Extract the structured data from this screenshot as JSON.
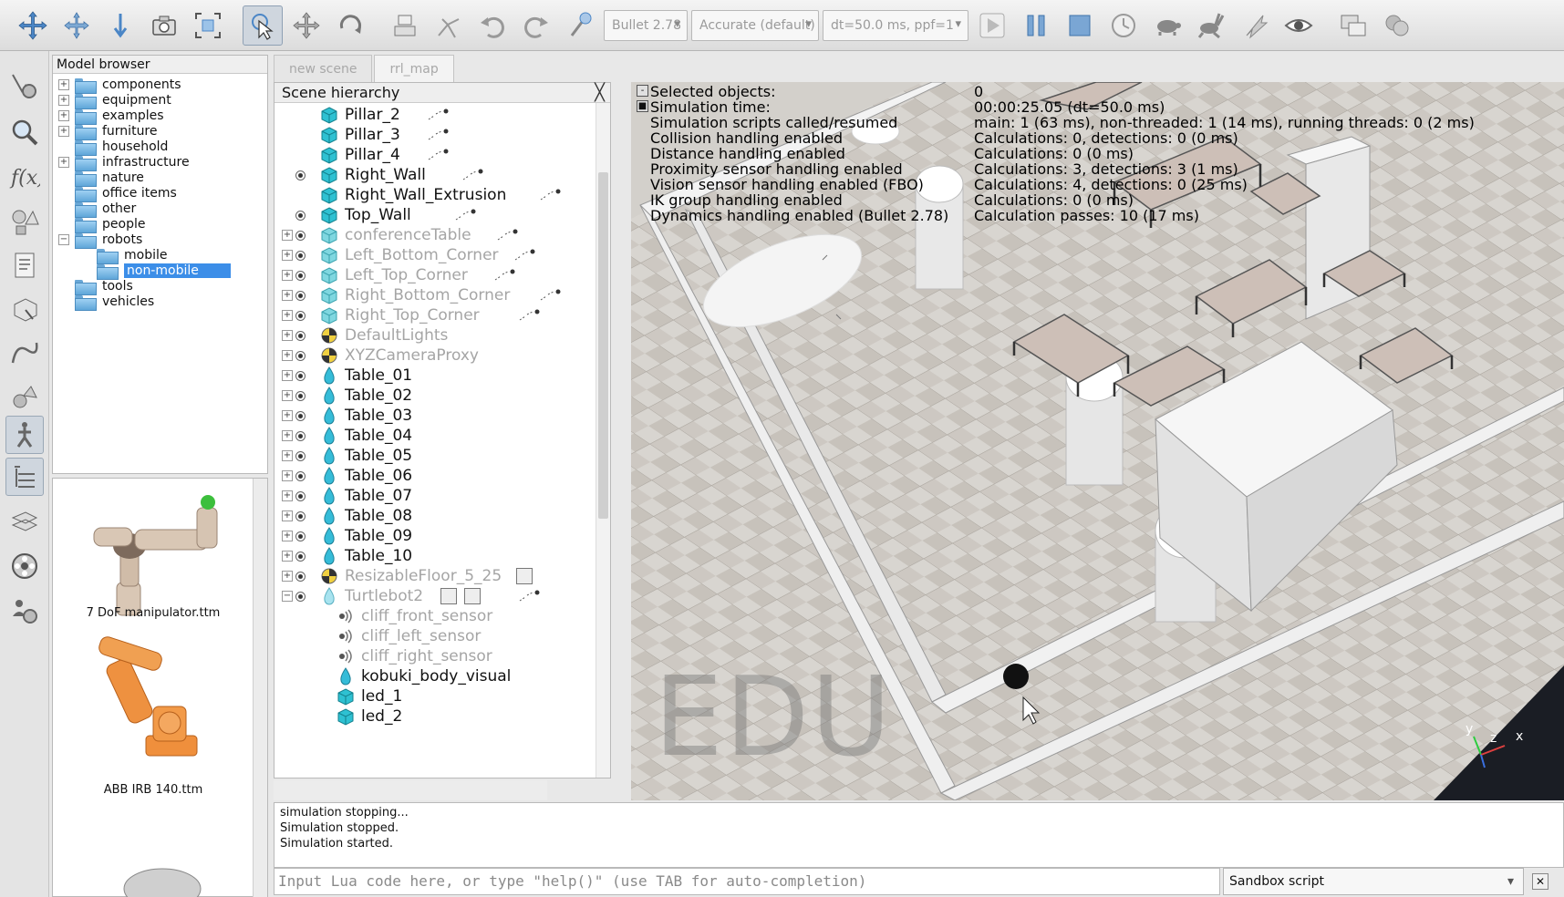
{
  "toolbar": {
    "engine": "Bullet 2.78",
    "accuracy": "Accurate (default)",
    "timestep": "dt=50.0 ms, ppf=1"
  },
  "model_browser": {
    "title": "Model browser",
    "folders": [
      {
        "label": "components",
        "expander": "+"
      },
      {
        "label": "equipment",
        "expander": "+"
      },
      {
        "label": "examples",
        "expander": "+"
      },
      {
        "label": "furniture",
        "expander": "+"
      },
      {
        "label": "household",
        "expander": ""
      },
      {
        "label": "infrastructure",
        "expander": "+"
      },
      {
        "label": "nature",
        "expander": ""
      },
      {
        "label": "office items",
        "expander": ""
      },
      {
        "label": "other",
        "expander": ""
      },
      {
        "label": "people",
        "expander": ""
      },
      {
        "label": "robots",
        "expander": "−"
      },
      {
        "label": "mobile",
        "expander": ""
      },
      {
        "label": "non-mobile",
        "expander": ""
      },
      {
        "label": "tools",
        "expander": ""
      },
      {
        "label": "vehicles",
        "expander": ""
      }
    ],
    "thumbnails": [
      "7 DoF manipulator.ttm",
      "ABB IRB 140.ttm"
    ]
  },
  "tabs": [
    "new scene",
    "rrl_map"
  ],
  "scene_hierarchy": {
    "title": "Scene hierarchy",
    "close": "╳",
    "items": [
      {
        "name": "Pillar_2"
      },
      {
        "name": "Pillar_3"
      },
      {
        "name": "Pillar_4"
      },
      {
        "name": "Right_Wall"
      },
      {
        "name": "Right_Wall_Extrusion"
      },
      {
        "name": "Top_Wall"
      },
      {
        "name": "conferenceTable"
      },
      {
        "name": "Left_Bottom_Corner"
      },
      {
        "name": "Left_Top_Corner"
      },
      {
        "name": "Right_Bottom_Corner"
      },
      {
        "name": "Right_Top_Corner"
      },
      {
        "name": "DefaultLights"
      },
      {
        "name": "XYZCameraProxy"
      },
      {
        "name": "Table_01"
      },
      {
        "name": "Table_02"
      },
      {
        "name": "Table_03"
      },
      {
        "name": "Table_04"
      },
      {
        "name": "Table_05"
      },
      {
        "name": "Table_06"
      },
      {
        "name": "Table_07"
      },
      {
        "name": "Table_08"
      },
      {
        "name": "Table_09"
      },
      {
        "name": "Table_10"
      },
      {
        "name": "ResizableFloor_5_25"
      },
      {
        "name": "Turtlebot2"
      },
      {
        "name": "cliff_front_sensor"
      },
      {
        "name": "cliff_left_sensor"
      },
      {
        "name": "cliff_right_sensor"
      },
      {
        "name": "kobuki_body_visual"
      },
      {
        "name": "led_1"
      },
      {
        "name": "led_2"
      }
    ]
  },
  "viewport": {
    "toggles": [
      "-",
      "■"
    ],
    "info": [
      {
        "label": "Selected objects:",
        "value": "0"
      },
      {
        "label": "Simulation time:",
        "value": "00:00:25.05 (dt=50.0 ms)"
      },
      {
        "label": "Simulation scripts called/resumed",
        "value": "main: 1 (63 ms), non-threaded: 1 (14 ms), running threads: 0 (2 ms)"
      },
      {
        "label": "Collision handling enabled",
        "value": "Calculations: 0, detections: 0 (0 ms)"
      },
      {
        "label": "Distance handling enabled",
        "value": "Calculations: 0 (0 ms)"
      },
      {
        "label": "Proximity sensor handling enabled",
        "value": "Calculations: 3, detections: 3 (1 ms)"
      },
      {
        "label": "Vision sensor handling enabled (FBO)",
        "value": "Calculations: 4, detections: 0 (25 ms)"
      },
      {
        "label": "IK group handling enabled",
        "value": "Calculations: 0 (0 ms)"
      },
      {
        "label": "Dynamics handling enabled (Bullet 2.78)",
        "value": "Calculation passes: 10 (17 ms)"
      }
    ],
    "watermark": "EDU",
    "axes": {
      "y": "y",
      "z": "z",
      "x": "x"
    }
  },
  "status": {
    "lines": [
      "simulation stopping...",
      "Simulation stopped.",
      "Simulation started."
    ]
  },
  "console": {
    "placeholder": "Input Lua code here, or type \"help()\" (use TAB for auto-completion)",
    "script": "Sandbox script",
    "close": "✕"
  },
  "colors": {
    "selection": "#3c8ee8",
    "shape_icon": "#28b8c8",
    "floor": "#d9d6d2",
    "wall": "#f2f2f2"
  }
}
